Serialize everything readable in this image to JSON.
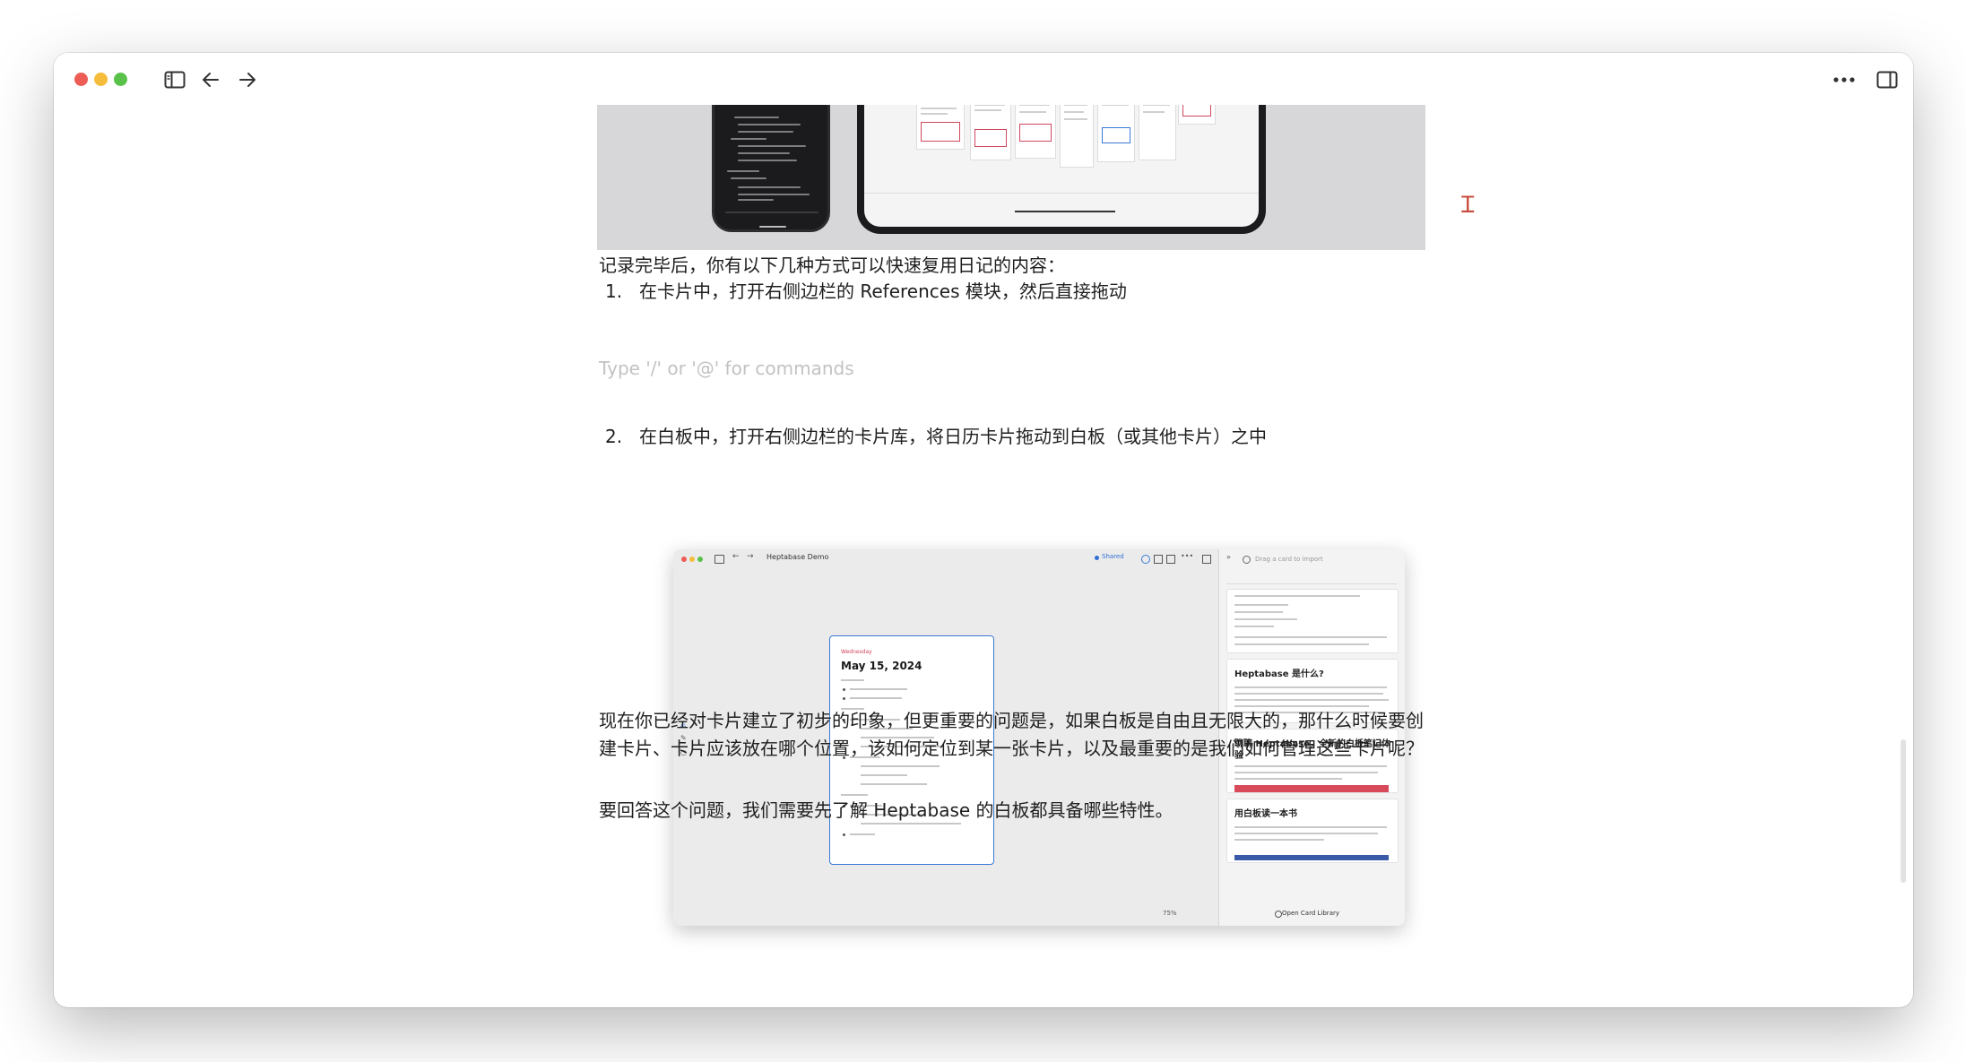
{
  "titlebar": {
    "icons": [
      "sidebar-toggle-icon",
      "arrow-left-icon",
      "arrow-right-icon",
      "more-icon",
      "right-panel-icon"
    ]
  },
  "doc": {
    "para1": "记录完毕后，你有以下几种方式可以快速复用日记的内容：",
    "list": [
      {
        "num": "1.",
        "text": "在卡片中，打开右侧边栏的 References 模块，然后直接拖动"
      },
      {
        "num": "2.",
        "text": "在白板中，打开右侧边栏的卡片库，将日历卡片拖动到白板（或其他卡片）之中"
      }
    ],
    "placeholder": "Type '/' or '@' for commands",
    "para2": "现在你已经对卡片建立了初步的印象，但更重要的问题是，如果白板是自由且无限大的，那什么时候要创建卡片、卡片应该放在哪个位置，该如何定位到某一张卡片，以及最重要的是我们如何管理这些卡片呢？",
    "para3": "要回答这个问题，我们需要先了解 Heptabase 的白板都具备哪些特性。"
  },
  "embedded": {
    "window_title": "Heptabase Demo",
    "shared_label": "Shared",
    "search_placeholder": "Drag a card to import",
    "day_of_week": "Wednesday",
    "date": "May 15, 2024",
    "cards": [
      "Heptabase 是什么?",
      "聊聊 Heptabase，全新的白板笔记体验",
      "用白板读一本书"
    ],
    "open_library": "Open Card Library",
    "zoom": "75%"
  },
  "colors": {
    "accent": "#3a79d8",
    "traffic_red": "#ee5d55",
    "traffic_yellow": "#f5bd3b",
    "traffic_green": "#5ac24a",
    "placeholder": "#c2c2c2"
  }
}
